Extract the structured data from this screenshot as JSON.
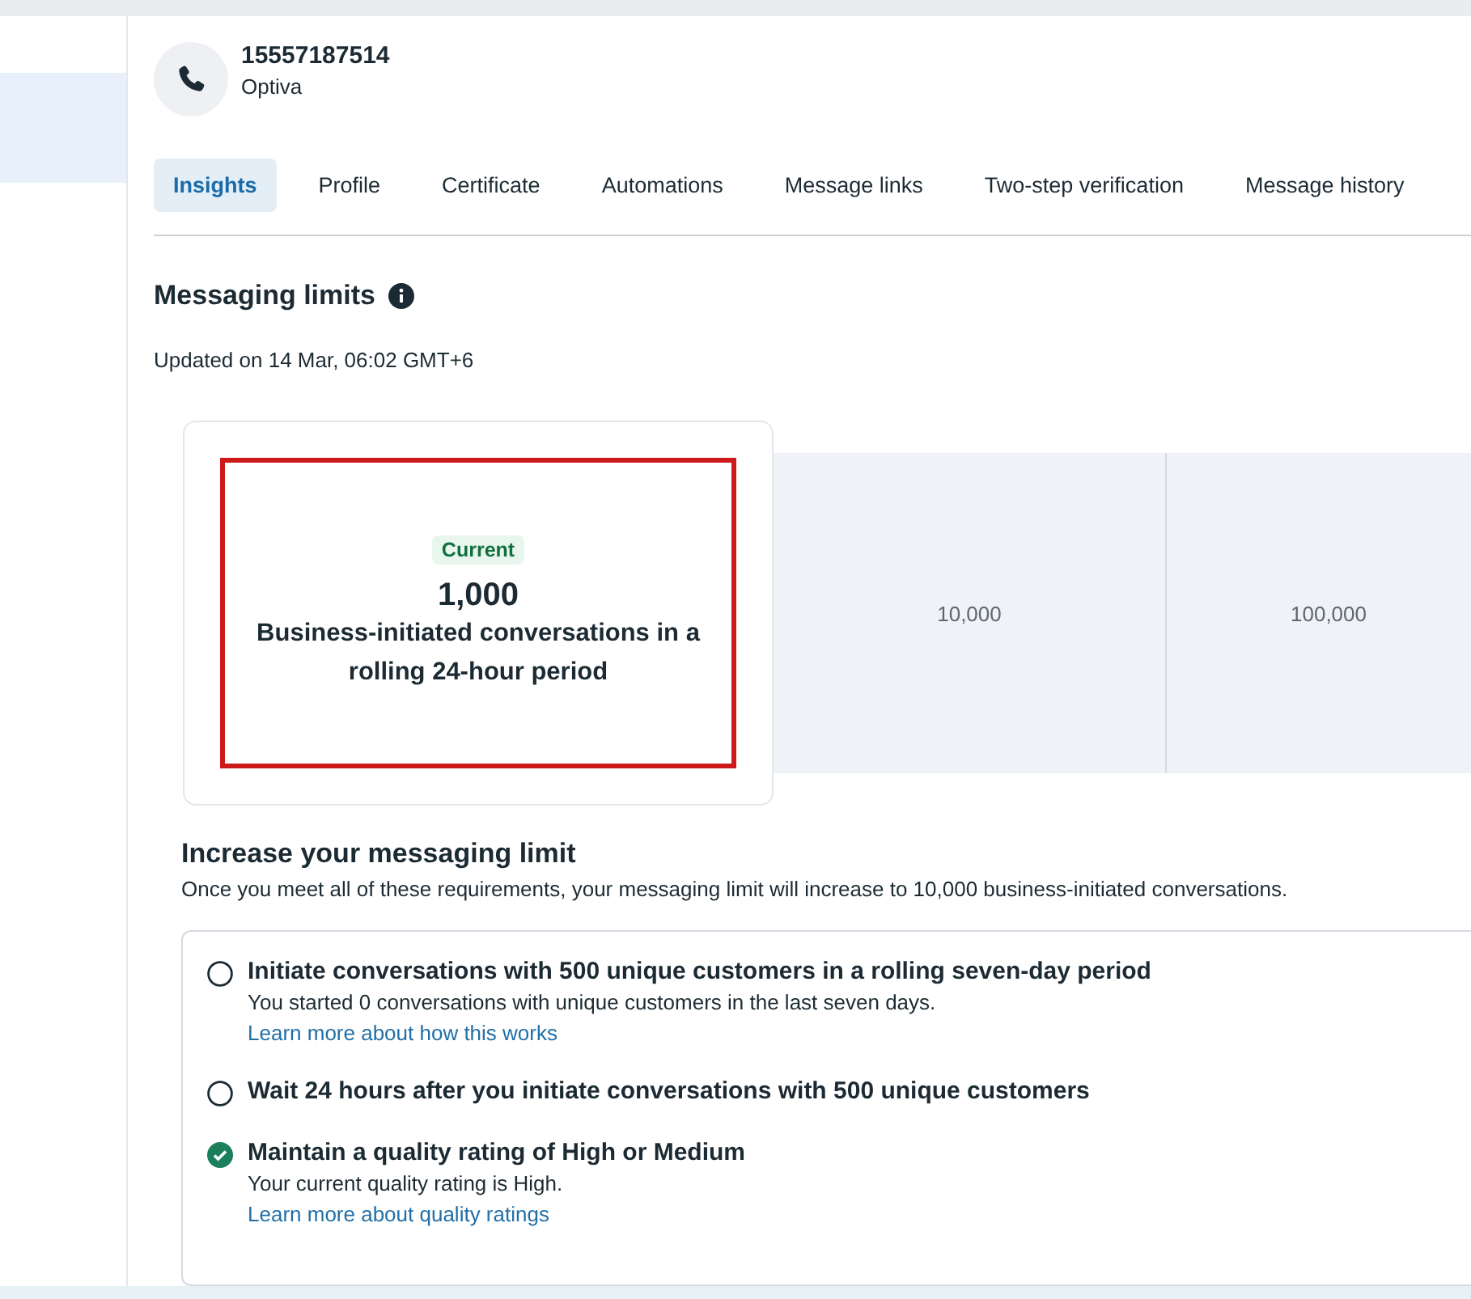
{
  "sidebar": {
    "items": [
      {
        "selected": true
      }
    ]
  },
  "header": {
    "number": "15557187514",
    "name": "Optiva"
  },
  "tabs": [
    {
      "label": "Insights",
      "selected": true
    },
    {
      "label": "Profile",
      "selected": false
    },
    {
      "label": "Certificate",
      "selected": false
    },
    {
      "label": "Automations",
      "selected": false
    },
    {
      "label": "Message links",
      "selected": false
    },
    {
      "label": "Two-step verification",
      "selected": false
    },
    {
      "label": "Message history",
      "selected": false
    }
  ],
  "limits": {
    "title": "Messaging limits",
    "updated": "Updated on 14 Mar, 06:02 GMT+6"
  },
  "tiers": [
    {
      "selected": true,
      "highlighted": true,
      "badge": "Current",
      "value": "1,000",
      "description": "Business-initiated conversations in a rolling 24-hour period"
    },
    {
      "selected": false,
      "value": "10,000"
    },
    {
      "selected": false,
      "value": "100,000"
    }
  ],
  "increase": {
    "title": "Increase your messaging limit",
    "description": "Once you meet all of these requirements, your messaging limit will increase to 10,000 business-initiated conversations."
  },
  "requirements": [
    {
      "checked": false,
      "title": "Initiate conversations with 500 unique customers in a rolling seven-day period",
      "detail": "You started 0 conversations with unique customers in the last seven days.",
      "link": "Learn more about how this works"
    },
    {
      "checked": false,
      "title": "Wait 24 hours after you initiate conversations with 500 unique customers"
    },
    {
      "checked": true,
      "title": "Maintain a quality rating of High or Medium",
      "detail": "Your current quality rating is High.",
      "link": "Learn more about quality ratings"
    }
  ]
}
